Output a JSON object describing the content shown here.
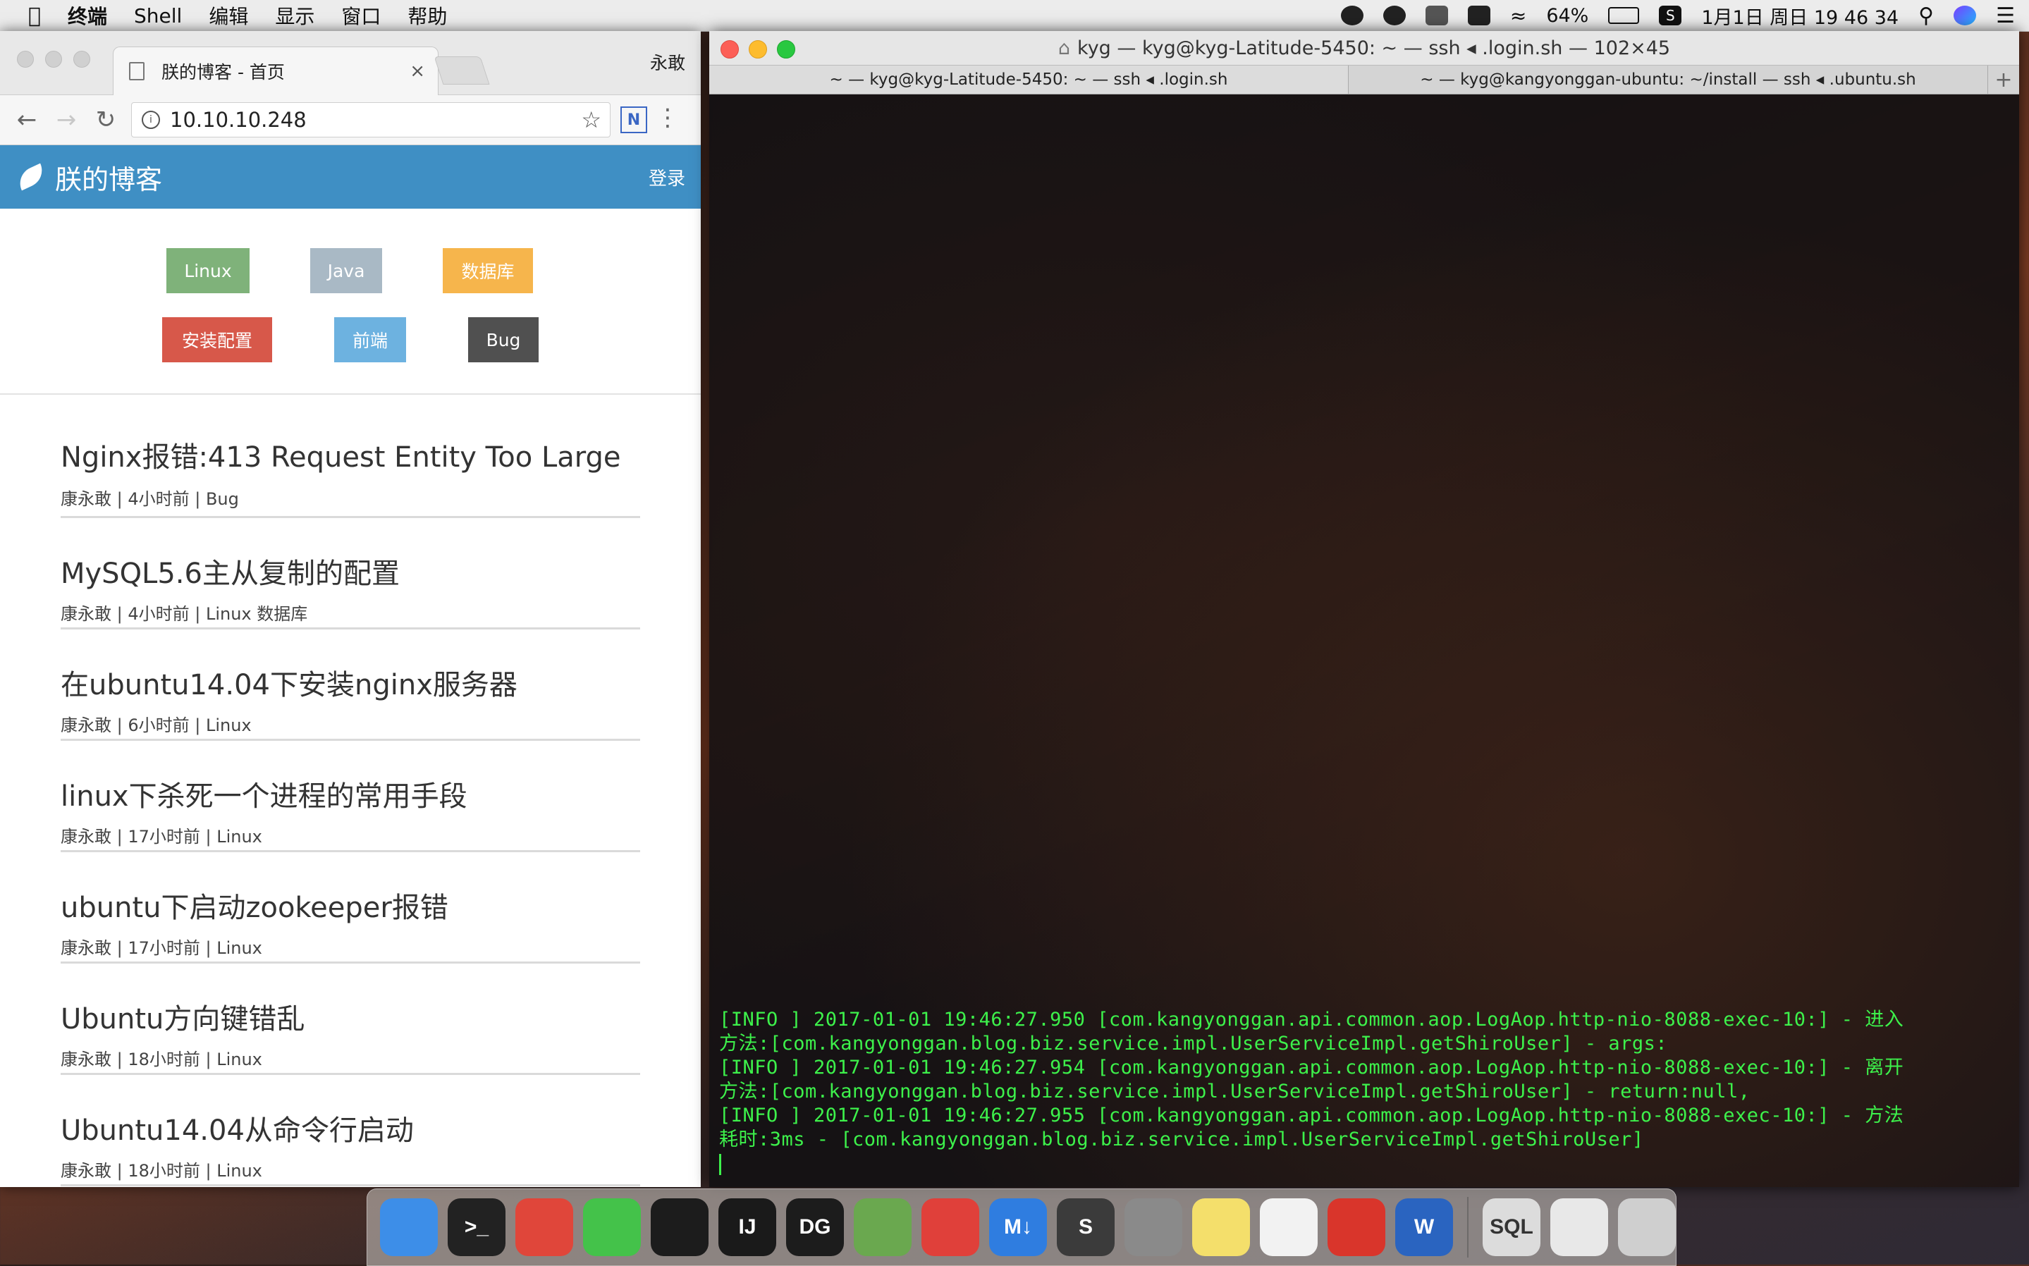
{
  "menubar": {
    "apple": "",
    "items": [
      "终端",
      "Shell",
      "编辑",
      "显示",
      "窗口",
      "帮助"
    ],
    "battery": "64%",
    "datetime": "1月1日 周日 19 46 34"
  },
  "browser": {
    "tab_title": "朕的博客 - 首页",
    "tab_close": "×",
    "profile": "永敢",
    "url": "10.10.10.248",
    "ext_label": "N",
    "blog": {
      "site_title": "朕的博客",
      "login": "登录",
      "tags": [
        {
          "label": "Linux",
          "color": "#7fb27a"
        },
        {
          "label": "Java",
          "color": "#a9b9c5"
        },
        {
          "label": "数据库",
          "color": "#f6b54c"
        },
        {
          "label": "安装配置",
          "color": "#d7584a"
        },
        {
          "label": "前端",
          "color": "#6db2e0"
        },
        {
          "label": "Bug",
          "color": "#505050"
        }
      ],
      "posts": [
        {
          "title": "Nginx报错:413 Request Entity Too Large",
          "meta": "康永敢 | 4小时前 | Bug"
        },
        {
          "title": "MySQL5.6主从复制的配置",
          "meta": "康永敢 | 4小时前 | Linux 数据库"
        },
        {
          "title": "在ubuntu14.04下安装nginx服务器",
          "meta": "康永敢 | 6小时前 | Linux"
        },
        {
          "title": "linux下杀死一个进程的常用手段",
          "meta": "康永敢 | 17小时前 | Linux"
        },
        {
          "title": "ubuntu下启动zookeeper报错",
          "meta": "康永敢 | 17小时前 | Linux"
        },
        {
          "title": "Ubuntu方向键错乱",
          "meta": "康永敢 | 18小时前 | Linux"
        },
        {
          "title": "Ubuntu14.04从命令行启动",
          "meta": "康永敢 | 18小时前 | Linux"
        }
      ]
    }
  },
  "terminal": {
    "window_title": "kyg — kyg@kyg-Latitude-5450: ~ — ssh ◂ .login.sh — 102×45",
    "tabs": [
      "~ — kyg@kyg-Latitude-5450: ~ — ssh ◂ .login.sh",
      "~ — kyg@kangyonggan-ubuntu: ~/install — ssh ◂ .ubuntu.sh"
    ],
    "plus": "+",
    "lines": [
      "[INFO ] 2017-01-01 19:46:27.950 [com.kangyonggan.api.common.aop.LogAop.http-nio-8088-exec-10:] - 进入",
      "方法:[com.kangyonggan.blog.biz.service.impl.UserServiceImpl.getShiroUser] - args:",
      "[INFO ] 2017-01-01 19:46:27.954 [com.kangyonggan.api.common.aop.LogAop.http-nio-8088-exec-10:] - 离开",
      "方法:[com.kangyonggan.blog.biz.service.impl.UserServiceImpl.getShiroUser] - return:null,",
      "[INFO ] 2017-01-01 19:46:27.955 [com.kangyonggan.api.common.aop.LogAop.http-nio-8088-exec-10:] - 方法",
      "耗时:3ms - [com.kangyonggan.blog.biz.service.impl.UserServiceImpl.getShiroUser]"
    ]
  },
  "dock": {
    "apps": [
      {
        "name": "finder-icon",
        "label": "",
        "color": "#3d8ee8"
      },
      {
        "name": "terminal-icon",
        "label": ">_",
        "color": "#222222"
      },
      {
        "name": "chrome-icon",
        "label": "",
        "color": "#e0463a"
      },
      {
        "name": "wechat-icon",
        "label": "",
        "color": "#44c24a"
      },
      {
        "name": "qq-icon",
        "label": "",
        "color": "#1c1c1c"
      },
      {
        "name": "intellij-icon",
        "label": "IJ",
        "color": "#1a1a1a"
      },
      {
        "name": "datagrip-icon",
        "label": "DG",
        "color": "#1c1c1c"
      },
      {
        "name": "android-studio-icon",
        "label": "",
        "color": "#6aa84f"
      },
      {
        "name": "git-client-icon",
        "label": "",
        "color": "#e0403a"
      },
      {
        "name": "markdown-icon",
        "label": "M↓",
        "color": "#2f7de0"
      },
      {
        "name": "sublime-icon",
        "label": "S",
        "color": "#3b3b3b"
      },
      {
        "name": "system-preferences-icon",
        "label": "",
        "color": "#8a8a8a"
      },
      {
        "name": "notes-icon",
        "label": "",
        "color": "#f4df6b"
      },
      {
        "name": "reminders-icon",
        "label": "",
        "color": "#f2f2f2"
      },
      {
        "name": "netease-music-icon",
        "label": "",
        "color": "#d9352b"
      },
      {
        "name": "word-icon",
        "label": "W",
        "color": "#2a64c0"
      }
    ],
    "docs": [
      {
        "name": "sql-file-icon",
        "label": "SQL",
        "color": "#dcdcdc"
      },
      {
        "name": "chrome-doc-icon",
        "label": "",
        "color": "#e8e8e8"
      },
      {
        "name": "trash-icon",
        "label": "",
        "color": "#cfcfcf"
      }
    ]
  }
}
